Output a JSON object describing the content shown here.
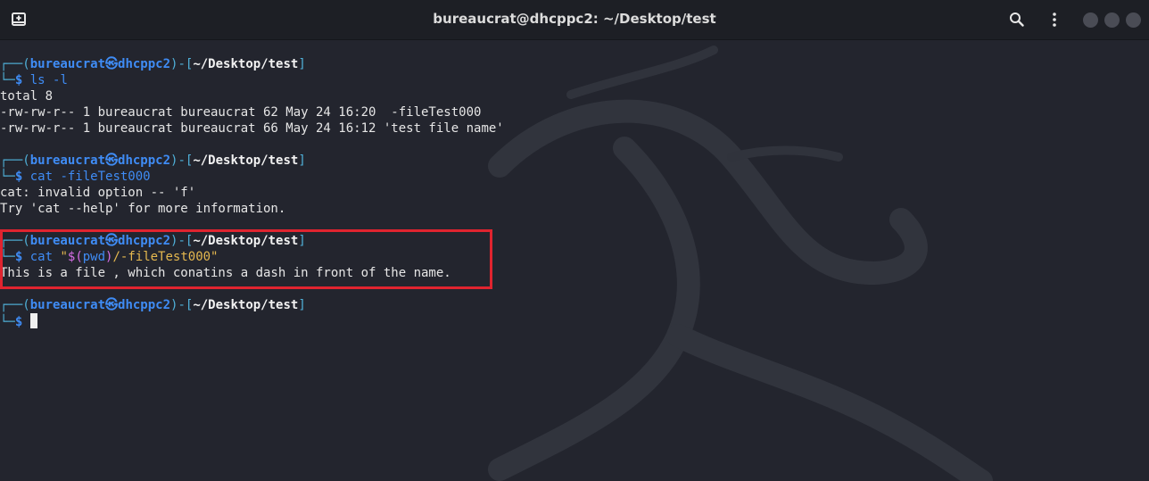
{
  "window": {
    "title": "bureaucrat@dhcppc2: ~/Desktop/test",
    "icons": {
      "new_tab": "new-tab-icon",
      "search": "search-icon",
      "menu": "kebab-menu-icon",
      "minimize": "minimize-dot",
      "maximize": "maximize-dot",
      "close": "close-dot"
    }
  },
  "prompt": {
    "box_top": "┌──(",
    "box_bottom": "└─",
    "user": "bureaucrat",
    "sep": "㉿",
    "host": "dhcppc2",
    "mid": ")-[",
    "path": "~/Desktop/test",
    "end": "]",
    "dollar": "$"
  },
  "blocks": [
    {
      "cmd_parts": [
        {
          "text": " ls -l",
          "style": "blue"
        }
      ],
      "output": [
        "total 8",
        "-rw-rw-r-- 1 bureaucrat bureaucrat 62 May 24 16:20  -fileTest000",
        "-rw-rw-r-- 1 bureaucrat bureaucrat 66 May 24 16:12 'test file name'"
      ]
    },
    {
      "cmd_parts": [
        {
          "text": " cat -fileTest000",
          "style": "blue"
        }
      ],
      "output": [
        "cat: invalid option -- 'f'",
        "Try 'cat --help' for more information."
      ]
    },
    {
      "cmd_parts": [
        {
          "text": " cat ",
          "style": "blue"
        },
        {
          "text": "\"",
          "style": "yellow"
        },
        {
          "text": "$(",
          "style": "magenta"
        },
        {
          "text": "pwd",
          "style": "blue"
        },
        {
          "text": ")",
          "style": "magenta"
        },
        {
          "text": "/-fileTest000\"",
          "style": "yellow"
        }
      ],
      "output": [
        "This is a file , which conatins a dash in front of the name."
      ]
    }
  ],
  "highlight_color": "#e0242f"
}
